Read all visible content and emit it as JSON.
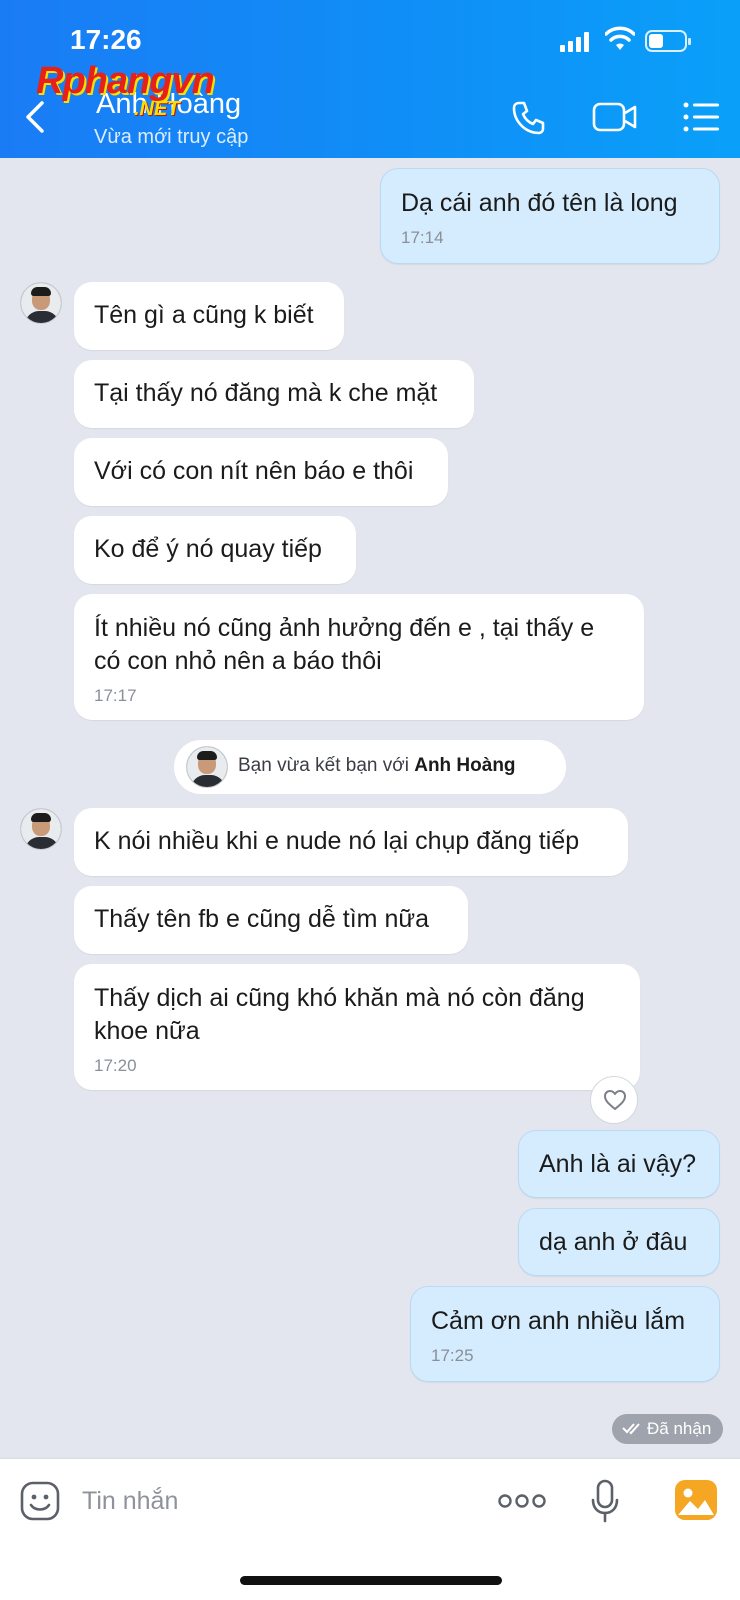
{
  "status_bar": {
    "time": "17:26"
  },
  "header": {
    "contact_name": "Anh Hoàng",
    "contact_status": "Vừa mới truy cập",
    "watermark_main": "Rphangvn",
    "watermark_sub": ".NET",
    "icons": [
      "back-chevron-icon",
      "phone-icon",
      "video-icon",
      "menu-list-icon"
    ]
  },
  "messages": [
    {
      "sender": "me",
      "text": "Dạ cái anh đó tên là long",
      "time": "17:14"
    },
    {
      "sender": "contact",
      "text": "Tên gì a cũng k biết"
    },
    {
      "sender": "contact",
      "text": "Tại thấy nó đăng mà k che mặt"
    },
    {
      "sender": "contact",
      "text": "Với có con nít nên báo e thôi"
    },
    {
      "sender": "contact",
      "text": "Ko để ý nó quay tiếp"
    },
    {
      "sender": "contact",
      "text": "Ít nhiều nó cũng ảnh hưởng đến e , tại thấy e có con nhỏ nên a báo thôi",
      "time": "17:17"
    },
    {
      "sender": "contact",
      "text": "K nói nhiều khi e nude nó lại chụp đăng tiếp"
    },
    {
      "sender": "contact",
      "text": "Thấy tên fb e cũng dễ tìm nữa"
    },
    {
      "sender": "contact",
      "text": "Thấy dịch ai cũng khó khăn mà nó còn đăng khoe nữa",
      "time": "17:20"
    },
    {
      "sender": "me",
      "text": "Anh là ai vậy?"
    },
    {
      "sender": "me",
      "text": "dạ anh ở đâu"
    },
    {
      "sender": "me",
      "text": "Cảm ơn anh nhiều lắm",
      "time": "17:25"
    }
  ],
  "system_notice": {
    "prefix": "Bạn vừa kết bạn với",
    "name": "Anh Hoàng"
  },
  "delivery_status": "Đã nhận",
  "composer": {
    "placeholder": "Tin nhắn",
    "icons": [
      "sticker-icon",
      "more-icon",
      "microphone-icon",
      "image-icon"
    ]
  },
  "colors": {
    "header_start": "#1a7cf5",
    "header_end": "#0aa0f9",
    "outgoing_bubble": "#d4ecfd",
    "background": "#e3e6ee"
  }
}
